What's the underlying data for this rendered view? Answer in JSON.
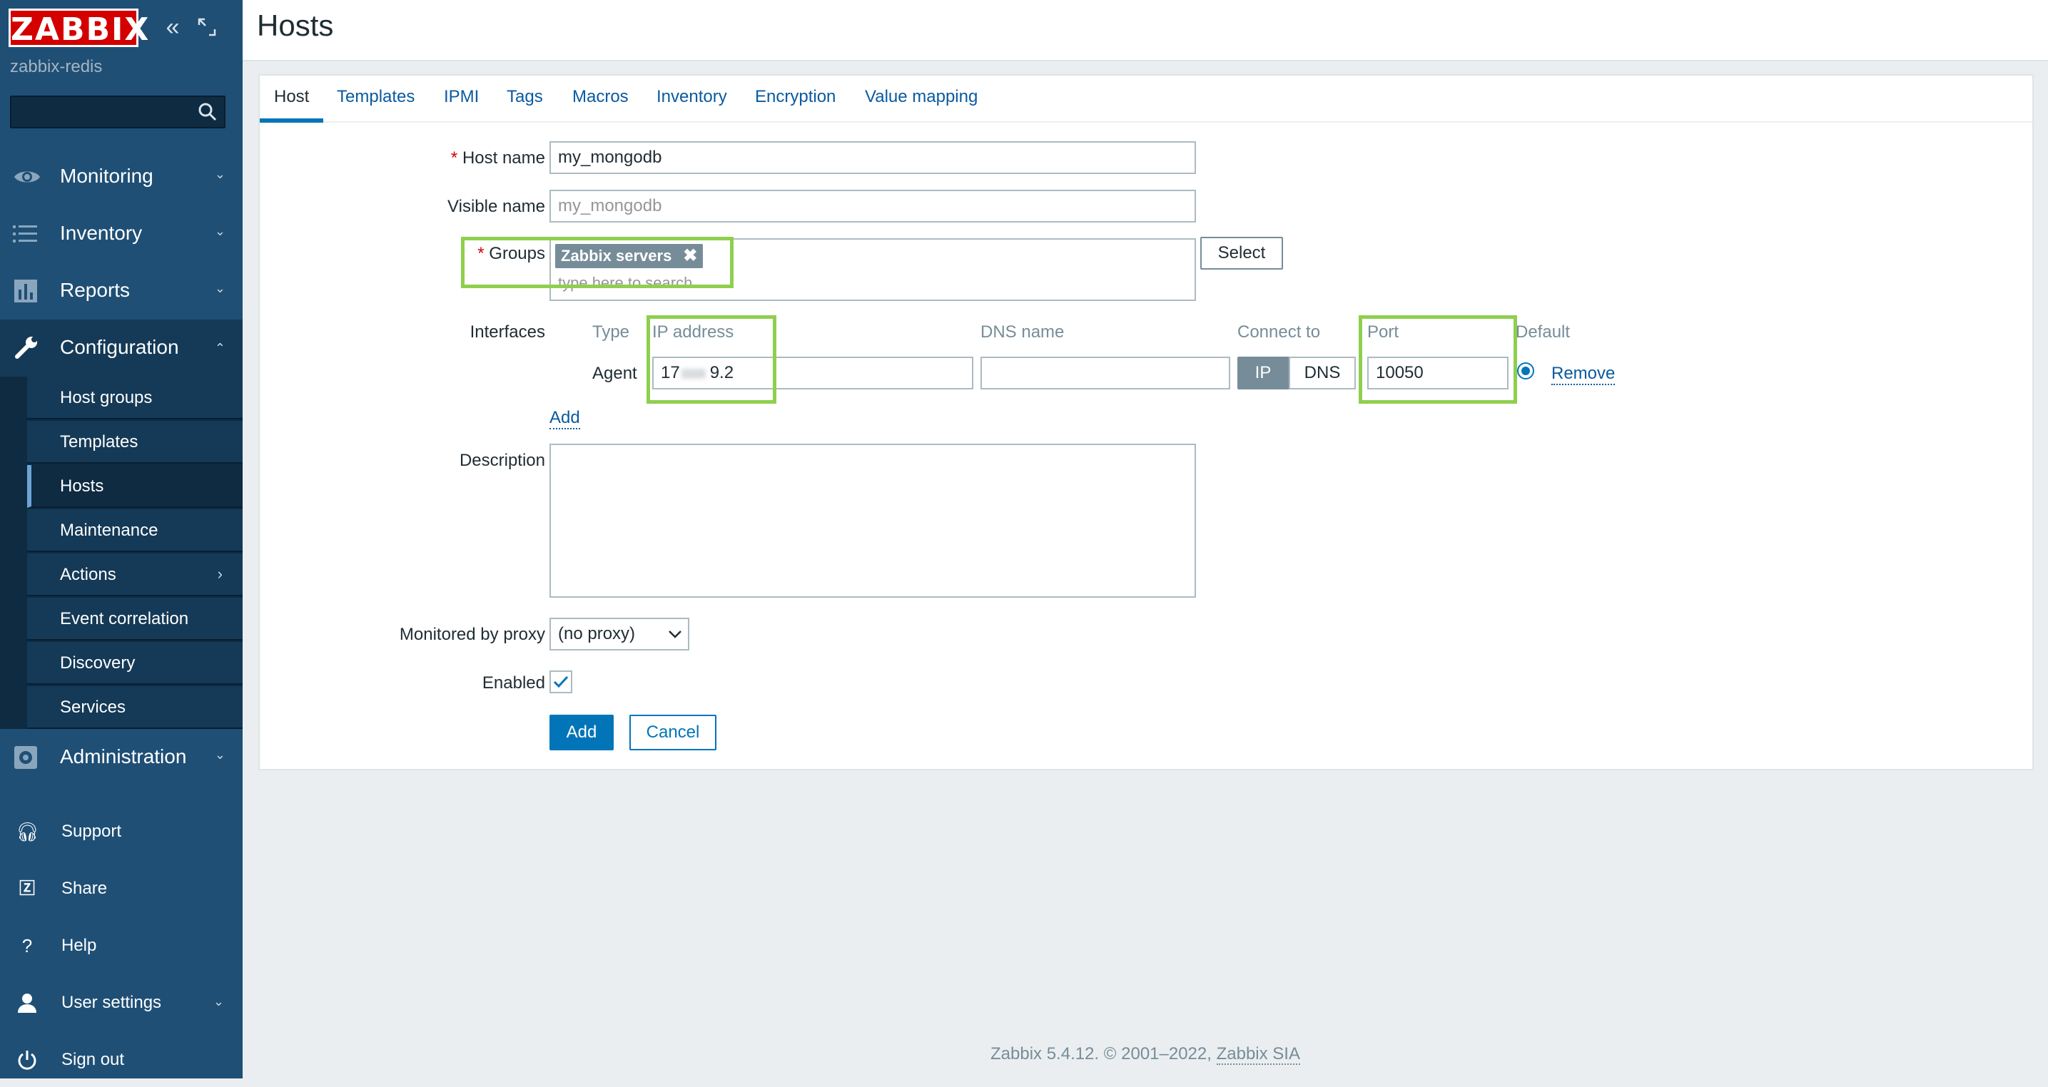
{
  "sidebar": {
    "logo": "ZABBIX",
    "server_name": "zabbix-redis",
    "search_placeholder": "",
    "menu": {
      "monitoring": "Monitoring",
      "inventory": "Inventory",
      "reports": "Reports",
      "configuration": "Configuration",
      "administration": "Administration"
    },
    "submenu": [
      "Host groups",
      "Templates",
      "Hosts",
      "Maintenance",
      "Actions",
      "Event correlation",
      "Discovery",
      "Services"
    ],
    "bottom": {
      "support": "Support",
      "share": "Share",
      "help": "Help",
      "user_settings": "User settings",
      "sign_out": "Sign out"
    }
  },
  "page": {
    "title": "Hosts"
  },
  "tabs": [
    "Host",
    "Templates",
    "IPMI",
    "Tags",
    "Macros",
    "Inventory",
    "Encryption",
    "Value mapping"
  ],
  "form": {
    "host_name_label": "Host name",
    "host_name_value": "my_mongodb",
    "visible_name_label": "Visible name",
    "visible_name_placeholder": "my_mongodb",
    "groups_label": "Groups",
    "groups_tag": "Zabbix servers",
    "groups_placeholder": "type here to search",
    "select_button": "Select",
    "interfaces_label": "Interfaces",
    "iface_headers": {
      "type": "Type",
      "ip": "IP address",
      "dns": "DNS name",
      "connect_to": "Connect to",
      "port": "Port",
      "default": "Default"
    },
    "agent_type": "Agent",
    "ip_value": "172.** 9.2",
    "ip_visible_prefix": "17",
    "ip_visible_suffix": "9.2",
    "dns_value": "",
    "connect_ip": "IP",
    "connect_dns": "DNS",
    "port_value": "10050",
    "remove_link": "Remove",
    "add_link": "Add",
    "description_label": "Description",
    "description_value": "",
    "proxy_label": "Monitored by proxy",
    "proxy_value": "(no proxy)",
    "enabled_label": "Enabled",
    "enabled": true,
    "add_button": "Add",
    "cancel_button": "Cancel"
  },
  "footer": {
    "text": "Zabbix 5.4.12. © 2001–2022,",
    "link": "Zabbix SIA"
  },
  "colors": {
    "sidebar": "#1f4f75",
    "accent": "#0275b8",
    "highlight": "#8fcf4e",
    "logo": "#d40000"
  }
}
